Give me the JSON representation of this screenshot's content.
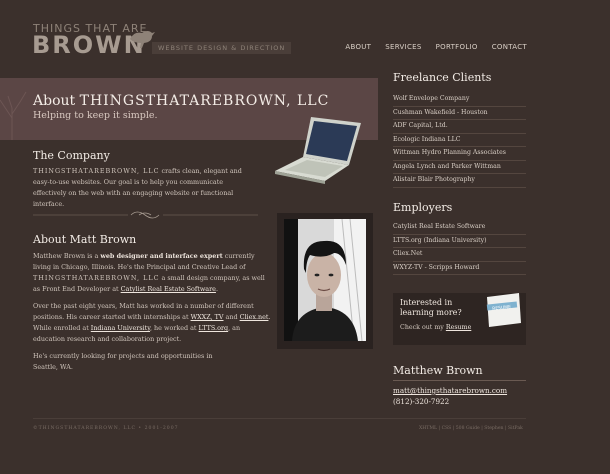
{
  "header": {
    "logo_top": "THINGS THAT ARE",
    "logo_main": "BROWN",
    "tagline": "WEBSITE DESIGN & DIRECTION",
    "nav": [
      "ABOUT",
      "SERVICES",
      "PORTFOLIO",
      "CONTACT"
    ]
  },
  "banner": {
    "title_prefix": "About",
    "title_caps": "THINGSTHATAREBROWN, LLC",
    "subtitle": "Helping to keep it simple."
  },
  "company": {
    "heading": "The Company",
    "caps": "THINGSTHATAREBROWN, LLC",
    "text": "crafts clean, elegant and easy-to-use websites. Our goal is to help you communicate effectively on the web with an engaging website or functional interface."
  },
  "matt": {
    "heading": "About Matt Brown",
    "p1_a": "Matthew Brown is a ",
    "p1_b": "web designer and interface expert",
    "p1_c": " currently living in Chicago, Illinois. He's the Principal and Creative Lead of ",
    "p1_d": "THINGSTHATAREBROWN, LLC",
    "p1_e": " a small design company, as well as Front End Developer at ",
    "p1_link": "Catylist Real Estate Software",
    "p1_f": ".",
    "p2_a": "Over the past eight years, Matt has worked in a number of different positions. His career started with internships at ",
    "p2_link1": "WXXZ, TV",
    "p2_b": " and ",
    "p2_link2": "Cliex.net",
    "p2_c": ". While enrolled at ",
    "p2_link3": "Indiana University",
    "p2_d": ", he worked at ",
    "p2_link4": "LTTS.org",
    "p2_e": ", an education research and collaboration project.",
    "p3": "He's currently looking for projects and opportunities in Seattle, WA."
  },
  "freelance": {
    "heading": "Freelance Clients",
    "items": [
      "Wolf Envelope Company",
      "Cushman Wakefield - Houston",
      "ADF Capital, Ltd.",
      "Ecologic Indiana LLC",
      "Wittman Hydro Planning Associates",
      "Angela Lynch and Parker Wittman",
      "Alistair Blair Photography"
    ]
  },
  "employers": {
    "heading": "Employers",
    "items": [
      "Catylist Real Estate Software",
      "LTTS.org (Indiana University)",
      "Cliex.Net",
      "WXYZ-TV - Scripps Howard"
    ]
  },
  "resume_box": {
    "line1": "Interested in learning more?",
    "line2_prefix": "Check out my ",
    "line2_link": "Resume",
    "icon_label": "RESUME"
  },
  "contact": {
    "name": "Matthew Brown",
    "email": "matt@thingsthatarebrown.com",
    "phone": "(812)-320-7922"
  },
  "footer": {
    "left": "©THINGSTHATAREBROWN, LLC • 2001-2007",
    "right": "XHTML | CSS | 508 Guide | Stephen | SitPak"
  }
}
